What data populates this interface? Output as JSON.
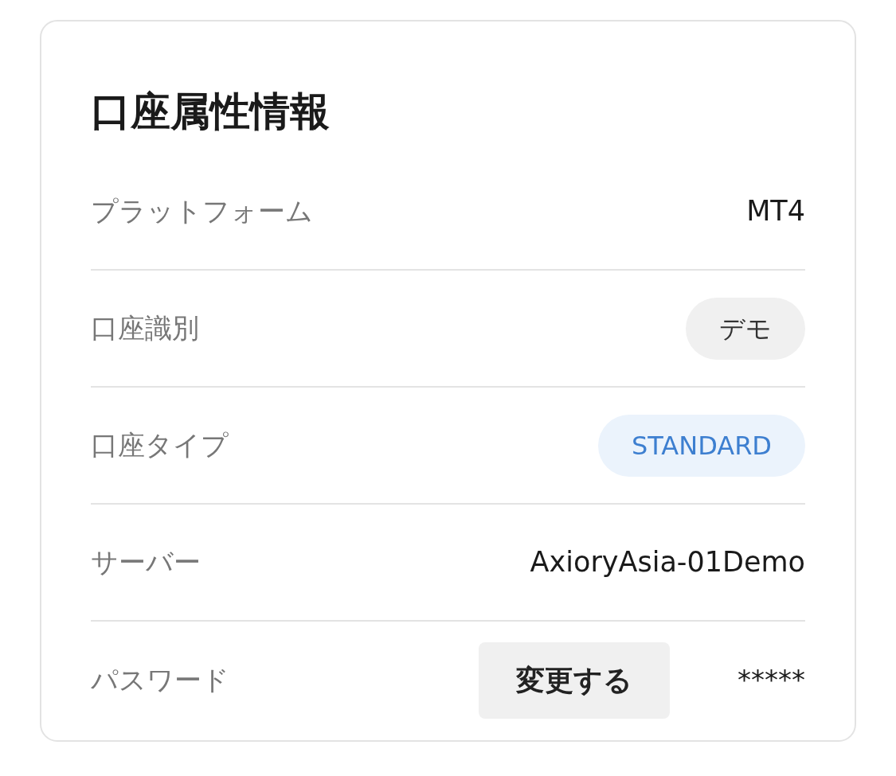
{
  "card": {
    "title": "口座属性情報",
    "rows": [
      {
        "label": "プラットフォーム",
        "kind": "text",
        "value": "MT4"
      },
      {
        "label": "口座識別",
        "kind": "badge",
        "value": "デモ"
      },
      {
        "label": "口座タイプ",
        "kind": "tag",
        "value": "STANDARD"
      },
      {
        "label": "サーバー",
        "kind": "text",
        "value": "AxioryAsia-01Demo"
      },
      {
        "label": "パスワード",
        "kind": "password",
        "button": "変更する",
        "value": "*****"
      }
    ]
  }
}
